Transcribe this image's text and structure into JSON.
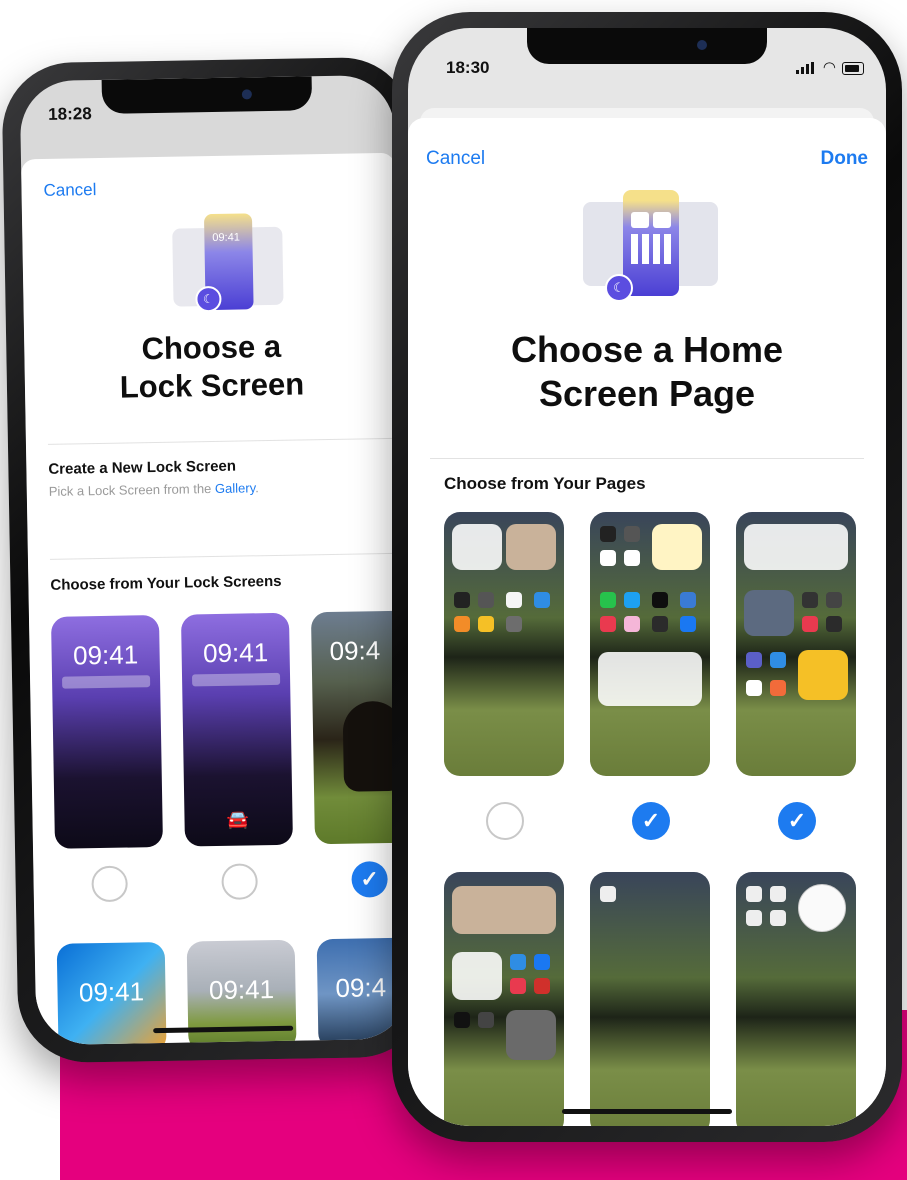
{
  "colors": {
    "accent": "#1d7bf0",
    "brand_magenta": "#e5007e"
  },
  "back_phone": {
    "time": "18:28",
    "cancel": "Cancel",
    "title_line1": "Choose a",
    "title_line2": "Lock Screen",
    "create_heading": "Create a New Lock Screen",
    "create_sub": "Pick a Lock Screen from the",
    "create_link": "Gallery",
    "create_end": ".",
    "section": "Choose from Your Lock Screens",
    "thumb_times": [
      "09:41",
      "09:41",
      "09:4",
      "09:41",
      "09:41",
      "09:4"
    ],
    "selection": [
      "unselected",
      "unselected",
      "selected"
    ]
  },
  "front_phone": {
    "time": "18:30",
    "cancel": "Cancel",
    "done": "Done",
    "title_line1": "Choose a Home",
    "title_line2": "Screen Page",
    "section": "Choose from Your Pages",
    "selection": [
      "unselected",
      "selected",
      "selected"
    ],
    "check_glyph": "✓"
  }
}
